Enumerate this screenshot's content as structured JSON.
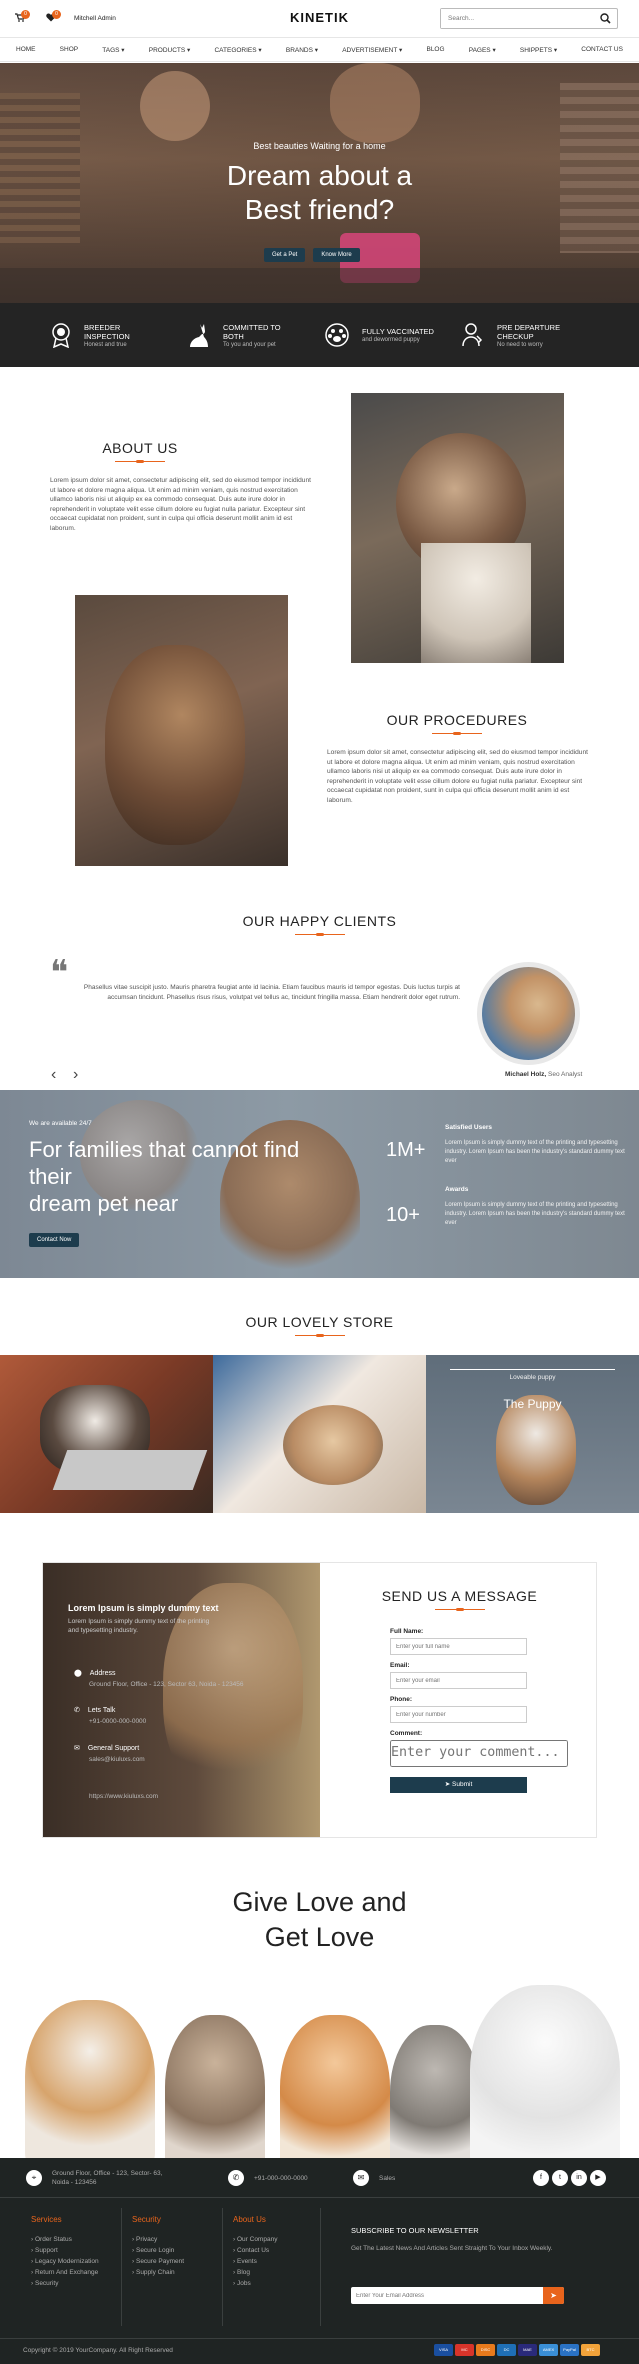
{
  "header": {
    "cart_count": "0",
    "wish_count": "0",
    "user_name": "Mitchell Admin",
    "logo": "KINETIK",
    "search_placeholder": "Search..."
  },
  "nav": {
    "items": [
      "HOME",
      "SHOP",
      "TAGS",
      "PRODUCTS",
      "CATEGORIES",
      "BRANDS",
      "ADVERTISEMENT",
      "BLOG",
      "PAGES",
      "SHIPPETS",
      "CONTACT US"
    ]
  },
  "hero": {
    "kicker": "Best beauties Waiting for a home",
    "title_line1": "Dream about a",
    "title_line2": "Best friend?",
    "btn_primary": "Get a Pet",
    "btn_secondary": "Know More"
  },
  "features": [
    {
      "title1": "BREEDER",
      "title2": "INSPECTION",
      "subtitle": "Honest and true",
      "icon": "medal-icon"
    },
    {
      "title1": "COMMITTED TO",
      "title2": "BOTH",
      "subtitle": "To you and your pet",
      "icon": "cat-icon"
    },
    {
      "title1": "FULLY VACCINATED",
      "title2": "",
      "subtitle": "and dewormed puppy",
      "icon": "paw-icon"
    },
    {
      "title1": "PRE DEPARTURE",
      "title2": "CHECKUP",
      "subtitle": "No need to worry",
      "icon": "vet-icon"
    }
  ],
  "about": {
    "heading": "ABOUT US",
    "text": "Lorem ipsum dolor sit amet, consectetur adipiscing elit, sed do eiusmod tempor incididunt ut labore et dolore magna aliqua. Ut enim ad minim veniam, quis nostrud exercitation ullamco laboris nisi ut aliquip ex ea commodo consequat. Duis aute irure dolor in reprehenderit in voluptate velit esse cillum dolore eu fugiat nulla pariatur. Excepteur sint occaecat cupidatat non proident, sunt in culpa qui officia deserunt mollit anim id est laborum."
  },
  "procedures": {
    "heading": "OUR PROCEDURES",
    "text": "Lorem ipsum dolor sit amet, consectetur adipiscing elit, sed do eiusmod tempor incididunt ut labore et dolore magna aliqua. Ut enim ad minim veniam, quis nostrud exercitation ullamco laboris nisi ut aliquip ex ea commodo consequat. Duis aute irure dolor in reprehenderit in voluptate velit esse cillum dolore eu fugiat nulla pariatur. Excepteur sint occaecat cupidatat non proident, sunt in culpa qui officia deserunt mollit anim id est laborum."
  },
  "clients": {
    "heading": "OUR HAPPY CLIENTS",
    "quote": "Phasellus vitae suscipit justo. Mauris pharetra feugiat ante id lacinia. Etiam faucibus mauris id tempor egestas. Duis luctus turpis at accumsan tincidunt. Phasellus risus risus, volutpat vel tellus ac, tincidunt fringilla massa. Etiam hendrerit dolor eget rutrum.",
    "author": "Michael Holz,",
    "role": "Seo Analyst"
  },
  "cta": {
    "kicker": "We are available 24/7",
    "title_line1": "For families that cannot find",
    "title_line2": "their",
    "title_line3": "dream pet near",
    "button": "Contact Now",
    "stats": [
      {
        "value": "1M+",
        "label": "Satisfied Users",
        "text": "Lorem Ipsum is simply dummy text of the printing and typesetting industry. Lorem Ipsum has been the industry's standard dummy text ever"
      },
      {
        "value": "10+",
        "label": "Awards",
        "text": "Lorem Ipsum is simply dummy text of the printing and typesetting industry. Lorem Ipsum has been the industry's standard dummy text ever"
      }
    ]
  },
  "store": {
    "heading": "OUR LOVELY STORE",
    "overlay_kicker": "Loveable puppy",
    "overlay_title": "The Puppy"
  },
  "contact": {
    "left_title": "Lorem Ipsum is simply dummy text",
    "left_text": "Lorem Ipsum is simply dummy text of the printing and typesetting industry.",
    "address_label": "Address",
    "address_value": "Ground Floor, Office - 123, Sector 63, Noida - 123456",
    "talk_label": "Lets Talk",
    "talk_value": "+91-0000-000-0000",
    "support_label": "General Support",
    "support_email": "sales@kiuluxs.com",
    "support_site": "https://www.kiuluxs.com",
    "form_heading": "SEND US A MESSAGE",
    "name_label": "Full Name:",
    "name_placeholder": "Enter your full name",
    "email_label": "Email:",
    "email_placeholder": "Enter your email",
    "phone_label": "Phone:",
    "phone_placeholder": "Enter your number",
    "comment_label": "Comment:",
    "comment_placeholder": "Enter your comment...",
    "submit": "Submit"
  },
  "love": {
    "line1": "Give Love and",
    "line2": "Get Love"
  },
  "footer": {
    "address": "Ground Floor, Office - 123, Sector- 63, Noida - 123456",
    "phone": "+91-000-000-0000",
    "email": "Sales",
    "services_title": "Services",
    "services": [
      "Order Status",
      "Support",
      "Legacy Modernization",
      "Return And Exchange",
      "Security"
    ],
    "security_title": "Security",
    "security": [
      "Privacy",
      "Secure Login",
      "Secure Payment",
      "Supply Chain"
    ],
    "about_title": "About Us",
    "about": [
      "Our Company",
      "Contact Us",
      "Events",
      "Blog",
      "Jobs"
    ],
    "newsletter_title": "SUBSCRIBE TO OUR NEWSLETTER",
    "newsletter_text": "Get The Latest News And Articles Sent Straight To Your Inbox Weekly.",
    "newsletter_placeholder": "Enter Your Email Address",
    "copyright": "Copyright © 2019 YourCompany. All Right Reserved",
    "payments": [
      "VISA",
      "MC",
      "DISC",
      "DC",
      "MAE",
      "AMEX",
      "PayPal",
      "BTC"
    ]
  },
  "colors": {
    "accent": "#e8641c",
    "dark": "#242424",
    "button": "#1d3c4d",
    "footer": "#1f2423"
  }
}
